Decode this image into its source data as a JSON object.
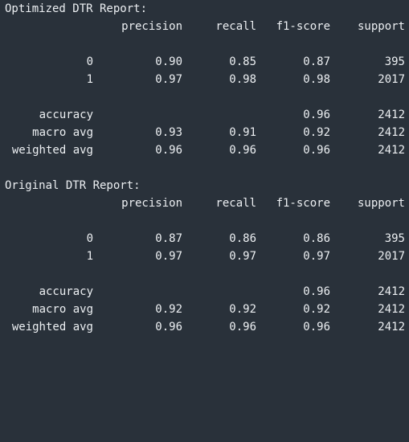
{
  "reports": [
    {
      "title": "Optimized DTR Report:",
      "headers": {
        "precision": "precision",
        "recall": "recall",
        "f1": "f1-score",
        "support": "support"
      },
      "classes": [
        {
          "label": "0",
          "precision": "0.90",
          "recall": "0.85",
          "f1": "0.87",
          "support": "395"
        },
        {
          "label": "1",
          "precision": "0.97",
          "recall": "0.98",
          "f1": "0.98",
          "support": "2017"
        }
      ],
      "accuracy": {
        "label": "accuracy",
        "f1": "0.96",
        "support": "2412"
      },
      "macro": {
        "label": "macro avg",
        "precision": "0.93",
        "recall": "0.91",
        "f1": "0.92",
        "support": "2412"
      },
      "weighted": {
        "label": "weighted avg",
        "precision": "0.96",
        "recall": "0.96",
        "f1": "0.96",
        "support": "2412"
      }
    },
    {
      "title": "Original DTR Report:",
      "headers": {
        "precision": "precision",
        "recall": "recall",
        "f1": "f1-score",
        "support": "support"
      },
      "classes": [
        {
          "label": "0",
          "precision": "0.87",
          "recall": "0.86",
          "f1": "0.86",
          "support": "395"
        },
        {
          "label": "1",
          "precision": "0.97",
          "recall": "0.97",
          "f1": "0.97",
          "support": "2017"
        }
      ],
      "accuracy": {
        "label": "accuracy",
        "f1": "0.96",
        "support": "2412"
      },
      "macro": {
        "label": "macro avg",
        "precision": "0.92",
        "recall": "0.92",
        "f1": "0.92",
        "support": "2412"
      },
      "weighted": {
        "label": "weighted avg",
        "precision": "0.96",
        "recall": "0.96",
        "f1": "0.96",
        "support": "2412"
      }
    }
  ]
}
